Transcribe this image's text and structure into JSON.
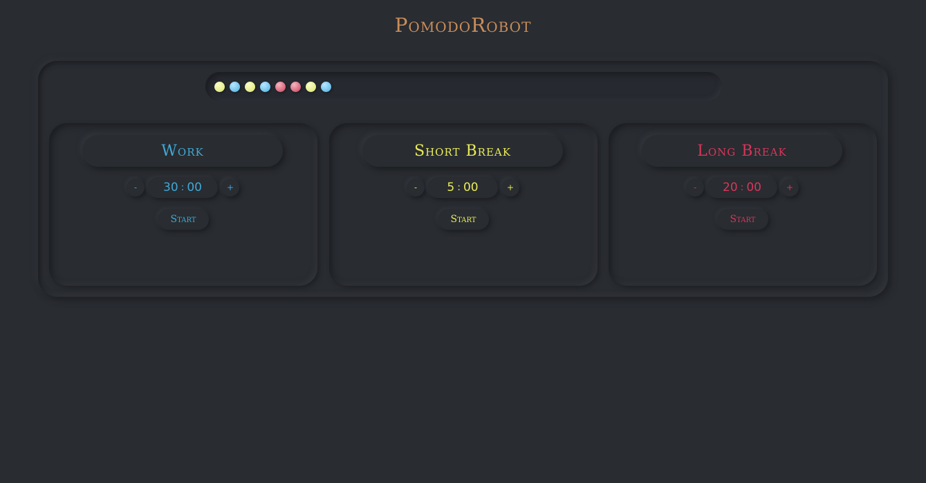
{
  "app": {
    "title": "PomodoRobot"
  },
  "colors": {
    "background": "#292c31",
    "title": "#c98d5a",
    "work": "#3fa9d8",
    "short_break": "#e9ec58",
    "long_break": "#d8365a"
  },
  "history": {
    "sessions": [
      "short",
      "work",
      "short",
      "work",
      "long",
      "long",
      "short",
      "work"
    ]
  },
  "timers": [
    {
      "key": "work",
      "label": "Work",
      "minutes": "30",
      "seconds": "00",
      "separator": ":",
      "decrement": "-",
      "increment": "+",
      "start_label": "Start"
    },
    {
      "key": "short",
      "label": "Short Break",
      "minutes": "5",
      "seconds": "00",
      "separator": ":",
      "decrement": "-",
      "increment": "+",
      "start_label": "Start"
    },
    {
      "key": "long",
      "label": "Long Break",
      "minutes": "20",
      "seconds": "00",
      "separator": ":",
      "decrement": "-",
      "increment": "+",
      "start_label": "Start"
    }
  ]
}
